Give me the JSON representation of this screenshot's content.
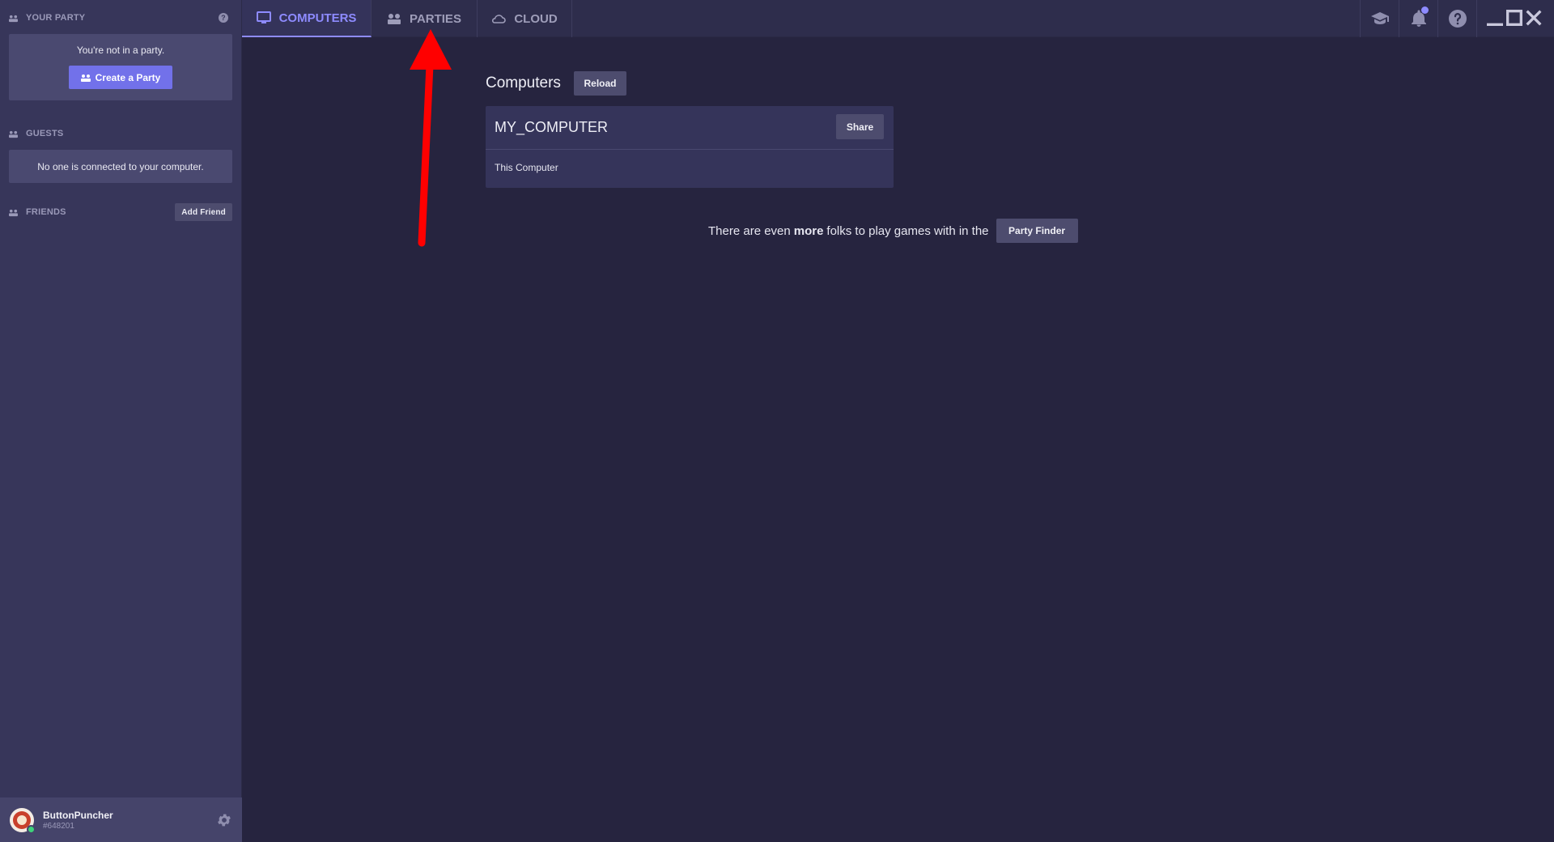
{
  "sidebar": {
    "your_party": {
      "title": "YOUR PARTY",
      "help_symbol": "?",
      "message": "You're not in a party.",
      "create_button": "Create a Party"
    },
    "guests": {
      "title": "GUESTS",
      "message": "No one is connected to your computer."
    },
    "friends": {
      "title": "FRIENDS",
      "add_button": "Add Friend"
    },
    "user": {
      "name": "ButtonPuncher",
      "tag": "#648201",
      "status_color": "#3ed27a"
    }
  },
  "topbar": {
    "tabs": [
      {
        "label": "COMPUTERS",
        "icon": "monitor-icon",
        "active": true
      },
      {
        "label": "PARTIES",
        "icon": "parties-icon",
        "active": false
      },
      {
        "label": "CLOUD",
        "icon": "cloud-icon",
        "active": false
      }
    ],
    "icons": [
      "graduation-cap-icon",
      "bell-icon",
      "help-circle-icon"
    ],
    "window_controls": [
      "minimize-icon",
      "maximize-icon",
      "close-icon"
    ]
  },
  "main": {
    "title": "Computers",
    "reload_button": "Reload",
    "computer": {
      "name": "MY_COMPUTER",
      "share_button": "Share",
      "subtitle": "This Computer"
    },
    "finder": {
      "text_before": "There are even",
      "bold": "more",
      "text_after": "folks to play games with in the",
      "button": "Party Finder"
    }
  },
  "colors": {
    "accent": "#8e8bff",
    "primary_button": "#7271ea",
    "annotation_arrow": "#ff0000"
  }
}
